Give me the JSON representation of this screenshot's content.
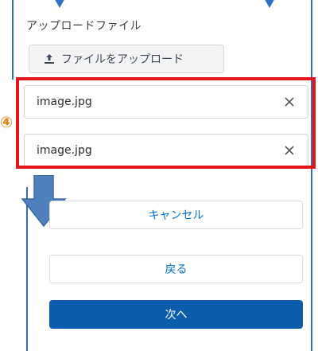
{
  "upload": {
    "section_label": "アップロードファイル",
    "button_label": "ファイルをアップロード",
    "button_icon": "upload-icon"
  },
  "files": [
    {
      "name": "image.jpg",
      "remove_icon": "close-icon"
    },
    {
      "name": "image.jpg",
      "remove_icon": "close-icon"
    }
  ],
  "annotation": {
    "step_marker": "④",
    "highlight_color": "#e4141a",
    "arrow_color": "#4f81bd"
  },
  "actions": {
    "cancel_label": "キャンセル",
    "back_label": "戻る",
    "next_label": "次へ",
    "primary_color": "#0b5cab"
  }
}
